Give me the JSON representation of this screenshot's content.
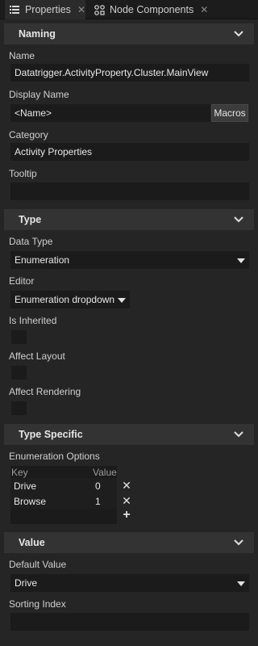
{
  "tabs": [
    {
      "label": "Properties",
      "icon": "list-icon",
      "active": true
    },
    {
      "label": "Node Components",
      "icon": "nodes-icon",
      "active": false
    }
  ],
  "sections": {
    "naming": {
      "title": "Naming"
    },
    "type": {
      "title": "Type"
    },
    "type_specific": {
      "title": "Type Specific"
    },
    "value": {
      "title": "Value"
    }
  },
  "naming": {
    "name_label": "Name",
    "name_value": "Datatrigger.ActivityProperty.Cluster.MainView",
    "display_name_label": "Display Name",
    "display_name_value": "<Name>",
    "macros_label": "Macros",
    "category_label": "Category",
    "category_value": "Activity Properties",
    "tooltip_label": "Tooltip",
    "tooltip_value": ""
  },
  "type": {
    "data_type_label": "Data Type",
    "data_type_value": "Enumeration",
    "editor_label": "Editor",
    "editor_value": "Enumeration dropdown",
    "is_inherited_label": "Is Inherited",
    "affect_layout_label": "Affect Layout",
    "affect_rendering_label": "Affect Rendering"
  },
  "type_specific": {
    "enum_options_label": "Enumeration Options",
    "key_header": "Key",
    "value_header": "Value",
    "rows": [
      {
        "key": "Drive",
        "value": "0"
      },
      {
        "key": "Browse",
        "value": "1"
      }
    ],
    "remove_symbol": "✕",
    "add_symbol": "+"
  },
  "value": {
    "default_value_label": "Default Value",
    "default_value": "Drive",
    "sorting_index_label": "Sorting Index",
    "sorting_index_value": ""
  }
}
